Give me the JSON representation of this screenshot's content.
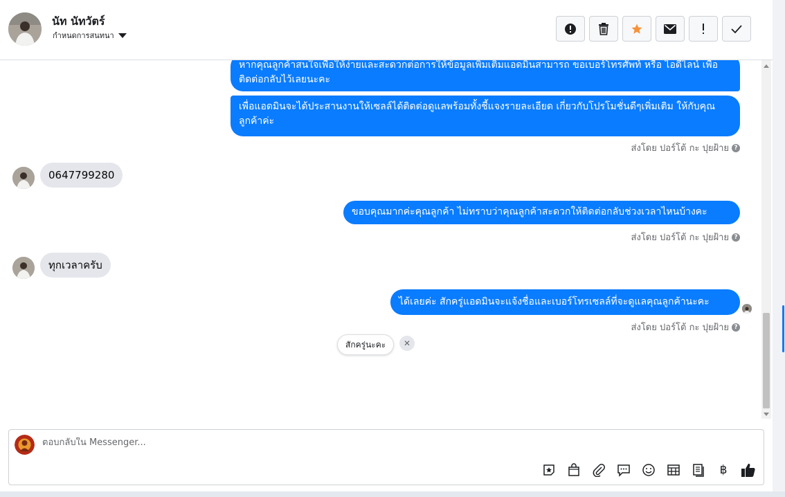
{
  "header": {
    "name": "นัท นัทวัตร์",
    "subtitle": "กำหนดการสนทนา",
    "toolbar": [
      {
        "icon": "alert-circle-icon"
      },
      {
        "icon": "trash-icon"
      },
      {
        "icon": "star-icon",
        "color": "#f7923a"
      },
      {
        "icon": "envelope-icon"
      },
      {
        "icon": "exclamation-icon"
      },
      {
        "icon": "checkmark-icon"
      }
    ]
  },
  "messages": {
    "out1": "หากคุณลูกค้าสนใจเพื่อให้ง่ายและสะดวกต่อการให้ข้อมูลเพิ่มเติมแอดมินสามารถ ขอเบอร์โทรศัพท์ หรือ ไอดีไลน์ เพื่อติดต่อกลับไว้เลยนะคะ",
    "out2": "เพื่อแอดมินจะได้ประสานงานให้เซลล์ได้ติดต่อดูแลพร้อมทั้งชี้แจงรายละเอียด เกี่ยวกับโปรโมชั่นดีๆเพิ่มเติม ให้กับคุณลูกค้าค่ะ",
    "sent_by_1": "ส่งโดย ปอร์โต้ กะ ปุยฝ้าย",
    "in1": "0647799280",
    "out3": "ขอบคุณมากค่ะคุณลูกค้า ไม่ทราบว่าคุณลูกค้าสะดวกให้ติดต่อกลับช่วงเวลาไหนบ้างคะ",
    "sent_by_2": "ส่งโดย ปอร์โต้ กะ ปุยฝ้าย",
    "in2": "ทุกเวลาครับ",
    "out4": "ได้เลยค่ะ สักครู่แอดมินจะแจ้งชื่อและเบอร์โทรเซลล์ที่จะดูแลคุณลูกค้านะคะ",
    "sent_by_3": "ส่งโดย ปอร์โต้ กะ ปุยฝ้าย",
    "help_glyph": "?"
  },
  "quick_reply": {
    "label": "สักครู่นะคะ",
    "close_glyph": "✕"
  },
  "composer": {
    "placeholder": "ตอบกลับใน Messenger...",
    "tools": [
      "sticker-icon",
      "bag-icon",
      "paperclip-icon",
      "chat-bubble-icon",
      "emoji-icon",
      "table-icon",
      "notes-icon",
      "baht-icon",
      "thumbs-up-icon"
    ],
    "baht_glyph": "฿"
  },
  "colors": {
    "outgoing_bubble": "#0a7cff",
    "incoming_bubble": "#e4e6eb",
    "star": "#f7923a"
  }
}
